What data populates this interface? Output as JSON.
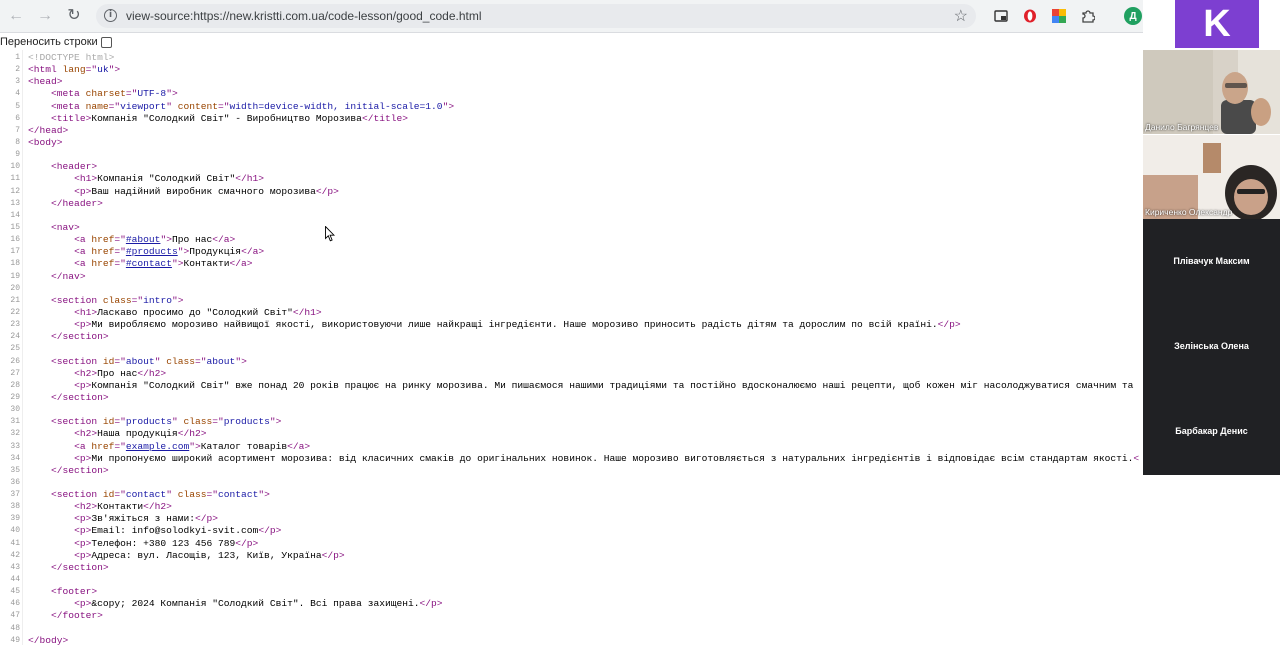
{
  "browser": {
    "url": "view-source:https://new.kristti.com.ua/code-lesson/good_code.html",
    "profile_initial": "Д"
  },
  "wrap": {
    "label": "Переносить строки"
  },
  "lines": [
    {
      "n": "1",
      "segs": [
        {
          "t": "<!DOCTYPE html>",
          "c": "cm"
        }
      ]
    },
    {
      "n": "2",
      "segs": [
        {
          "t": "<html ",
          "c": "tag"
        },
        {
          "t": "lang",
          "c": "an"
        },
        {
          "t": "=\"",
          "c": "tag"
        },
        {
          "t": "uk",
          "c": "av"
        },
        {
          "t": "\">",
          "c": "tag"
        }
      ]
    },
    {
      "n": "3",
      "segs": [
        {
          "t": "<head>",
          "c": "tag"
        }
      ]
    },
    {
      "n": "4",
      "segs": [
        {
          "t": "    "
        },
        {
          "t": "<meta ",
          "c": "tag"
        },
        {
          "t": "charset",
          "c": "an"
        },
        {
          "t": "=\"",
          "c": "tag"
        },
        {
          "t": "UTF-8",
          "c": "av"
        },
        {
          "t": "\">",
          "c": "tag"
        }
      ]
    },
    {
      "n": "5",
      "segs": [
        {
          "t": "    "
        },
        {
          "t": "<meta ",
          "c": "tag"
        },
        {
          "t": "name",
          "c": "an"
        },
        {
          "t": "=\"",
          "c": "tag"
        },
        {
          "t": "viewport",
          "c": "av"
        },
        {
          "t": "\" ",
          "c": "tag"
        },
        {
          "t": "content",
          "c": "an"
        },
        {
          "t": "=\"",
          "c": "tag"
        },
        {
          "t": "width=device-width, initial-scale=1.0",
          "c": "av"
        },
        {
          "t": "\">",
          "c": "tag"
        }
      ]
    },
    {
      "n": "6",
      "segs": [
        {
          "t": "    "
        },
        {
          "t": "<title>",
          "c": "tag"
        },
        {
          "t": "Компанія \"Солодкий Світ\" - Виробництво Морозива"
        },
        {
          "t": "</title>",
          "c": "tag"
        }
      ]
    },
    {
      "n": "7",
      "segs": [
        {
          "t": "</head>",
          "c": "tag"
        }
      ]
    },
    {
      "n": "8",
      "segs": [
        {
          "t": "<body>",
          "c": "tag"
        }
      ]
    },
    {
      "n": "9",
      "segs": []
    },
    {
      "n": "10",
      "segs": [
        {
          "t": "    "
        },
        {
          "t": "<header>",
          "c": "tag"
        }
      ]
    },
    {
      "n": "11",
      "segs": [
        {
          "t": "        "
        },
        {
          "t": "<h1>",
          "c": "tag"
        },
        {
          "t": "Компанія \"Солодкий Світ\""
        },
        {
          "t": "</h1>",
          "c": "tag"
        }
      ]
    },
    {
      "n": "12",
      "segs": [
        {
          "t": "        "
        },
        {
          "t": "<p>",
          "c": "tag"
        },
        {
          "t": "Ваш надійний виробник смачного морозива"
        },
        {
          "t": "</p>",
          "c": "tag"
        }
      ]
    },
    {
      "n": "13",
      "segs": [
        {
          "t": "    "
        },
        {
          "t": "</header>",
          "c": "tag"
        }
      ]
    },
    {
      "n": "14",
      "segs": []
    },
    {
      "n": "15",
      "segs": [
        {
          "t": "    "
        },
        {
          "t": "<nav>",
          "c": "tag"
        }
      ]
    },
    {
      "n": "16",
      "segs": [
        {
          "t": "        "
        },
        {
          "t": "<a ",
          "c": "tag"
        },
        {
          "t": "href",
          "c": "an"
        },
        {
          "t": "=\"",
          "c": "tag"
        },
        {
          "t": "#about",
          "c": "lk"
        },
        {
          "t": "\">",
          "c": "tag"
        },
        {
          "t": "Про нас"
        },
        {
          "t": "</a>",
          "c": "tag"
        }
      ]
    },
    {
      "n": "17",
      "segs": [
        {
          "t": "        "
        },
        {
          "t": "<a ",
          "c": "tag"
        },
        {
          "t": "href",
          "c": "an"
        },
        {
          "t": "=\"",
          "c": "tag"
        },
        {
          "t": "#products",
          "c": "lk"
        },
        {
          "t": "\">",
          "c": "tag"
        },
        {
          "t": "Продукція"
        },
        {
          "t": "</a>",
          "c": "tag"
        }
      ]
    },
    {
      "n": "18",
      "segs": [
        {
          "t": "        "
        },
        {
          "t": "<a ",
          "c": "tag"
        },
        {
          "t": "href",
          "c": "an"
        },
        {
          "t": "=\"",
          "c": "tag"
        },
        {
          "t": "#contact",
          "c": "lk"
        },
        {
          "t": "\">",
          "c": "tag"
        },
        {
          "t": "Контакти"
        },
        {
          "t": "</a>",
          "c": "tag"
        }
      ]
    },
    {
      "n": "19",
      "segs": [
        {
          "t": "    "
        },
        {
          "t": "</nav>",
          "c": "tag"
        }
      ]
    },
    {
      "n": "20",
      "segs": []
    },
    {
      "n": "21",
      "segs": [
        {
          "t": "    "
        },
        {
          "t": "<section ",
          "c": "tag"
        },
        {
          "t": "class",
          "c": "an"
        },
        {
          "t": "=\"",
          "c": "tag"
        },
        {
          "t": "intro",
          "c": "av"
        },
        {
          "t": "\">",
          "c": "tag"
        }
      ]
    },
    {
      "n": "22",
      "segs": [
        {
          "t": "        "
        },
        {
          "t": "<h1>",
          "c": "tag"
        },
        {
          "t": "Ласкаво просимо до \"Солодкий Світ\""
        },
        {
          "t": "</h1>",
          "c": "tag"
        }
      ]
    },
    {
      "n": "23",
      "segs": [
        {
          "t": "        "
        },
        {
          "t": "<p>",
          "c": "tag"
        },
        {
          "t": "Ми виробляємо морозиво найвищої якості, використовуючи лише найкращі інгредієнти. Наше морозиво приносить радість дітям та дорослим по всій країні."
        },
        {
          "t": "</p>",
          "c": "tag"
        }
      ]
    },
    {
      "n": "24",
      "segs": [
        {
          "t": "    "
        },
        {
          "t": "</section>",
          "c": "tag"
        }
      ]
    },
    {
      "n": "25",
      "segs": []
    },
    {
      "n": "26",
      "segs": [
        {
          "t": "    "
        },
        {
          "t": "<section ",
          "c": "tag"
        },
        {
          "t": "id",
          "c": "an"
        },
        {
          "t": "=\"",
          "c": "tag"
        },
        {
          "t": "about",
          "c": "av"
        },
        {
          "t": "\" ",
          "c": "tag"
        },
        {
          "t": "class",
          "c": "an"
        },
        {
          "t": "=\"",
          "c": "tag"
        },
        {
          "t": "about",
          "c": "av"
        },
        {
          "t": "\">",
          "c": "tag"
        }
      ]
    },
    {
      "n": "27",
      "segs": [
        {
          "t": "        "
        },
        {
          "t": "<h2>",
          "c": "tag"
        },
        {
          "t": "Про нас"
        },
        {
          "t": "</h2>",
          "c": "tag"
        }
      ]
    },
    {
      "n": "28",
      "segs": [
        {
          "t": "        "
        },
        {
          "t": "<p>",
          "c": "tag"
        },
        {
          "t": "Компанія \"Солодкий Світ\" вже понад 20 років працює на ринку морозива. Ми пишаємося нашими традиціями та постійно вдосконалюємо наші рецепти, щоб кожен міг насолоджуватися смачним та"
        }
      ]
    },
    {
      "n": "29",
      "segs": [
        {
          "t": "    "
        },
        {
          "t": "</section>",
          "c": "tag"
        }
      ]
    },
    {
      "n": "30",
      "segs": []
    },
    {
      "n": "31",
      "segs": [
        {
          "t": "    "
        },
        {
          "t": "<section ",
          "c": "tag"
        },
        {
          "t": "id",
          "c": "an"
        },
        {
          "t": "=\"",
          "c": "tag"
        },
        {
          "t": "products",
          "c": "av"
        },
        {
          "t": "\" ",
          "c": "tag"
        },
        {
          "t": "class",
          "c": "an"
        },
        {
          "t": "=\"",
          "c": "tag"
        },
        {
          "t": "products",
          "c": "av"
        },
        {
          "t": "\">",
          "c": "tag"
        }
      ]
    },
    {
      "n": "32",
      "segs": [
        {
          "t": "        "
        },
        {
          "t": "<h2>",
          "c": "tag"
        },
        {
          "t": "Наша продукція"
        },
        {
          "t": "</h2>",
          "c": "tag"
        }
      ]
    },
    {
      "n": "33",
      "segs": [
        {
          "t": "        "
        },
        {
          "t": "<a ",
          "c": "tag"
        },
        {
          "t": "href",
          "c": "an"
        },
        {
          "t": "=\"",
          "c": "tag"
        },
        {
          "t": "example.com",
          "c": "lk"
        },
        {
          "t": "\">",
          "c": "tag"
        },
        {
          "t": "Каталог товарів"
        },
        {
          "t": "</a>",
          "c": "tag"
        }
      ]
    },
    {
      "n": "34",
      "segs": [
        {
          "t": "        "
        },
        {
          "t": "<p>",
          "c": "tag"
        },
        {
          "t": "Ми пропонуємо широкий асортимент морозива: від класичних смаків до оригінальних новинок. Наше морозиво виготовляється з натуральних інгредієнтів і відповідає всім стандартам якості."
        },
        {
          "t": "<",
          "c": "tag"
        }
      ]
    },
    {
      "n": "35",
      "segs": [
        {
          "t": "    "
        },
        {
          "t": "</section>",
          "c": "tag"
        }
      ]
    },
    {
      "n": "36",
      "segs": []
    },
    {
      "n": "37",
      "segs": [
        {
          "t": "    "
        },
        {
          "t": "<section ",
          "c": "tag"
        },
        {
          "t": "id",
          "c": "an"
        },
        {
          "t": "=\"",
          "c": "tag"
        },
        {
          "t": "contact",
          "c": "av"
        },
        {
          "t": "\" ",
          "c": "tag"
        },
        {
          "t": "class",
          "c": "an"
        },
        {
          "t": "=\"",
          "c": "tag"
        },
        {
          "t": "contact",
          "c": "av"
        },
        {
          "t": "\">",
          "c": "tag"
        }
      ]
    },
    {
      "n": "38",
      "segs": [
        {
          "t": "        "
        },
        {
          "t": "<h2>",
          "c": "tag"
        },
        {
          "t": "Контакти"
        },
        {
          "t": "</h2>",
          "c": "tag"
        }
      ]
    },
    {
      "n": "39",
      "segs": [
        {
          "t": "        "
        },
        {
          "t": "<p>",
          "c": "tag"
        },
        {
          "t": "Зв'яжіться з нами:"
        },
        {
          "t": "</p>",
          "c": "tag"
        }
      ]
    },
    {
      "n": "40",
      "segs": [
        {
          "t": "        "
        },
        {
          "t": "<p>",
          "c": "tag"
        },
        {
          "t": "Email: info@solodkyi-svit.com"
        },
        {
          "t": "</p>",
          "c": "tag"
        }
      ]
    },
    {
      "n": "41",
      "segs": [
        {
          "t": "        "
        },
        {
          "t": "<p>",
          "c": "tag"
        },
        {
          "t": "Телефон: +380 123 456 789"
        },
        {
          "t": "</p>",
          "c": "tag"
        }
      ]
    },
    {
      "n": "42",
      "segs": [
        {
          "t": "        "
        },
        {
          "t": "<p>",
          "c": "tag"
        },
        {
          "t": "Адреса: вул. Ласощів, 123, Київ, Україна"
        },
        {
          "t": "</p>",
          "c": "tag"
        }
      ]
    },
    {
      "n": "43",
      "segs": [
        {
          "t": "    "
        },
        {
          "t": "</section>",
          "c": "tag"
        }
      ]
    },
    {
      "n": "44",
      "segs": []
    },
    {
      "n": "45",
      "segs": [
        {
          "t": "    "
        },
        {
          "t": "<footer>",
          "c": "tag"
        }
      ]
    },
    {
      "n": "46",
      "segs": [
        {
          "t": "        "
        },
        {
          "t": "<p>",
          "c": "tag"
        },
        {
          "t": "&copy; 2024 Компанія \"Солодкий Світ\". Всі права захищені."
        },
        {
          "t": "</p>",
          "c": "tag"
        }
      ]
    },
    {
      "n": "47",
      "segs": [
        {
          "t": "    "
        },
        {
          "t": "</footer>",
          "c": "tag"
        }
      ]
    },
    {
      "n": "48",
      "segs": []
    },
    {
      "n": "49",
      "segs": [
        {
          "t": "</body>",
          "c": "tag"
        }
      ]
    }
  ],
  "meeting": {
    "logo_letter": "K",
    "participants": [
      {
        "name": "Данило Багрянцев"
      },
      {
        "name": "Кириченко Олександр"
      },
      {
        "name": "Плівачук Максим"
      },
      {
        "name": "Зелінська Олена"
      },
      {
        "name": "Барбакар Денис"
      }
    ]
  }
}
